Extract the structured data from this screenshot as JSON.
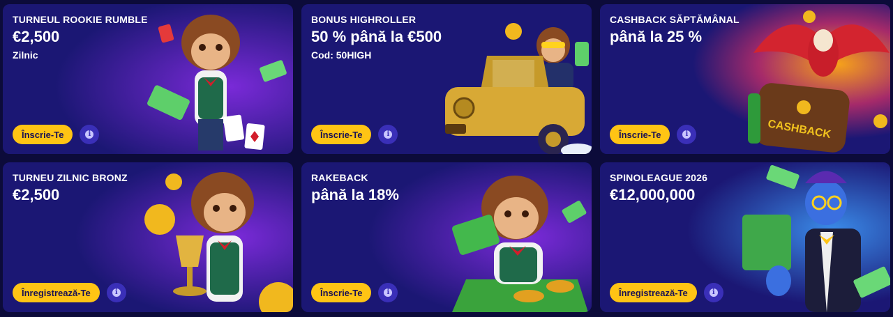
{
  "colors": {
    "card_bg": "#1b1774",
    "card_bg_purple": "#6a21c9",
    "button_bg": "#ffc414",
    "button_text": "#1a1254",
    "info_bg": "#3a2fb8",
    "page_bg": "#0c0b3a"
  },
  "cards": [
    {
      "eyebrow": "TURNEUL ROOKIE RUMBLE",
      "headline": "€2,500",
      "sub": "Zilnic",
      "button": "Înscrie-Te",
      "info_icon": "info-icon",
      "illustration": "monkey-with-cards-and-cash"
    },
    {
      "eyebrow": "BONUS HIGHROLLER",
      "headline": "50 % până la €500",
      "sub": "Cod: 50HIGH",
      "button": "Înscrie-Te",
      "info_icon": "info-icon",
      "illustration": "monkey-in-golden-car"
    },
    {
      "eyebrow": "CASHBACK SĂPTĂMÂNAL",
      "headline": "până la 25 %",
      "sub": "",
      "button": "Înscrie-Te",
      "info_icon": "info-icon",
      "illustration": "parrot-with-cashback-wallet",
      "illustration_text": "CASHBACK"
    },
    {
      "eyebrow": "TURNEU ZILNIC BRONZ",
      "headline": "€2,500",
      "sub": "",
      "button": "Înregistrează-Te",
      "info_icon": "info-icon",
      "illustration": "monkey-with-golden-goblet"
    },
    {
      "eyebrow": "RAKEBACK",
      "headline": "până la 18%",
      "sub": "",
      "button": "Înscrie-Te",
      "info_icon": "info-icon",
      "illustration": "monkey-with-cash-and-chips"
    },
    {
      "eyebrow": "SPINOLEAGUE 2026",
      "headline": "€12,000,000",
      "sub": "",
      "button": "Înregistrează-Te",
      "info_icon": "info-icon",
      "illustration": "genie-with-money-stack"
    }
  ]
}
